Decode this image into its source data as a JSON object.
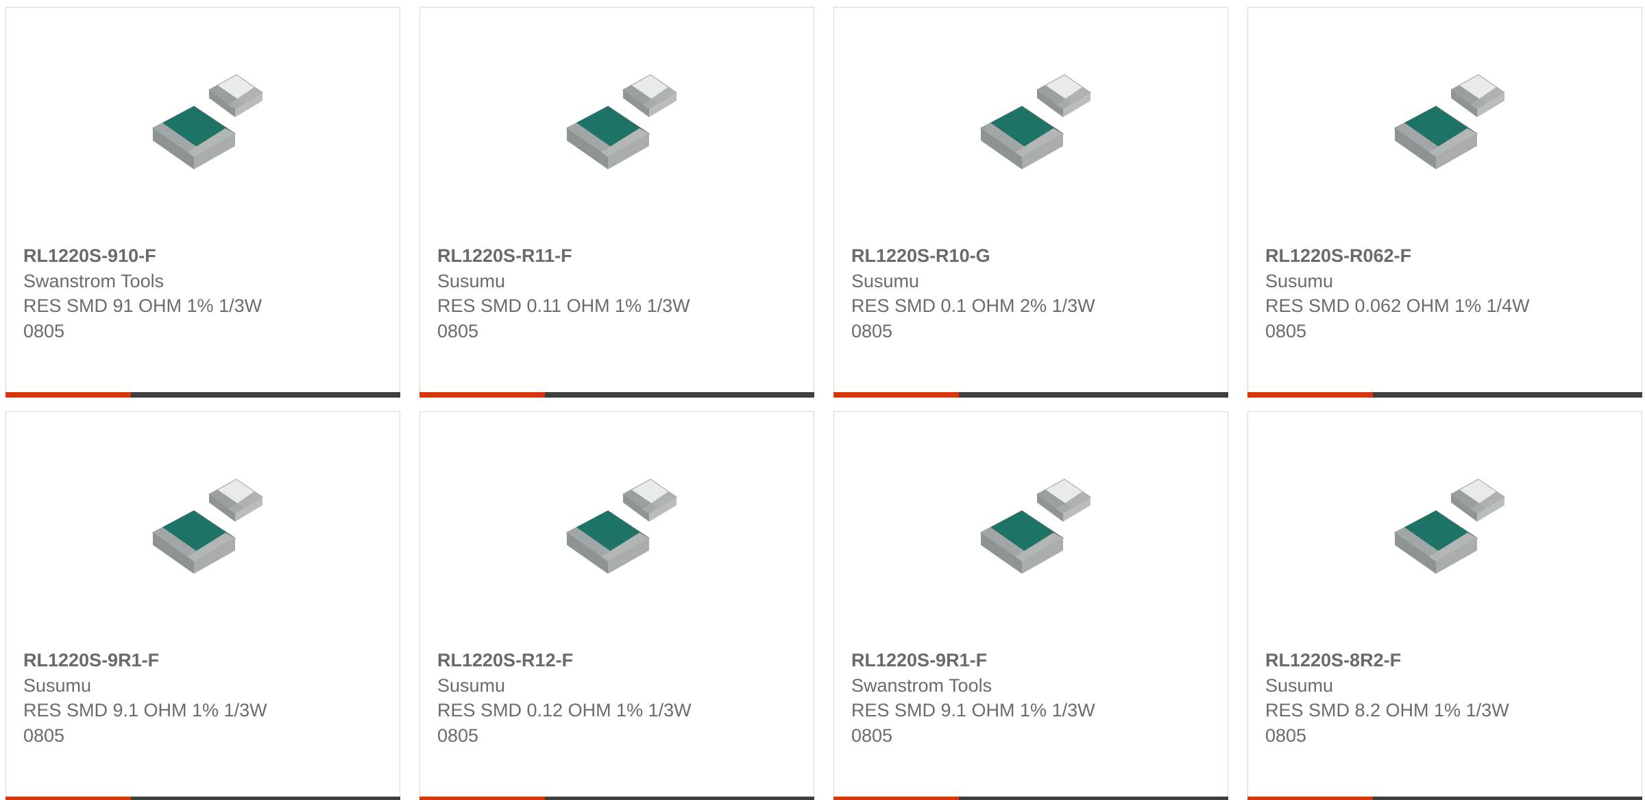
{
  "colors": {
    "accent": "#d9360b",
    "bar_dark": "#3f3f3f",
    "text": "#6b6b6b",
    "border": "#d6d6d6",
    "resistor_body": "#1d7466"
  },
  "products": [
    {
      "part_number": "RL1220S-910-F",
      "manufacturer": "Swanstrom Tools",
      "description_line1": "RES SMD 91 OHM 1% 1/3W",
      "description_line2": "0805",
      "image_icon": "smd-resistor-image"
    },
    {
      "part_number": "RL1220S-R11-F",
      "manufacturer": "Susumu",
      "description_line1": "RES SMD 0.11 OHM 1% 1/3W",
      "description_line2": "0805",
      "image_icon": "smd-resistor-image"
    },
    {
      "part_number": "RL1220S-R10-G",
      "manufacturer": "Susumu",
      "description_line1": "RES SMD 0.1 OHM 2% 1/3W",
      "description_line2": "0805",
      "image_icon": "smd-resistor-image"
    },
    {
      "part_number": "RL1220S-R062-F",
      "manufacturer": "Susumu",
      "description_line1": "RES SMD 0.062 OHM 1% 1/4W",
      "description_line2": "0805",
      "image_icon": "smd-resistor-image"
    },
    {
      "part_number": "RL1220S-9R1-F",
      "manufacturer": "Susumu",
      "description_line1": "RES SMD 9.1 OHM 1% 1/3W",
      "description_line2": "0805",
      "image_icon": "smd-resistor-image"
    },
    {
      "part_number": "RL1220S-R12-F",
      "manufacturer": "Susumu",
      "description_line1": "RES SMD 0.12 OHM 1% 1/3W",
      "description_line2": "0805",
      "image_icon": "smd-resistor-image"
    },
    {
      "part_number": "RL1220S-9R1-F",
      "manufacturer": "Swanstrom Tools",
      "description_line1": "RES SMD 9.1 OHM 1% 1/3W",
      "description_line2": "0805",
      "image_icon": "smd-resistor-image"
    },
    {
      "part_number": "RL1220S-8R2-F",
      "manufacturer": "Susumu",
      "description_line1": "RES SMD 8.2 OHM 1% 1/3W",
      "description_line2": "0805",
      "image_icon": "smd-resistor-image"
    }
  ]
}
